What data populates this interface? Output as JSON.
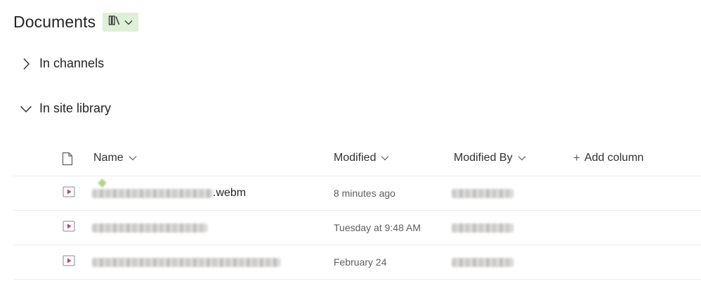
{
  "header": {
    "title": "Documents"
  },
  "sections": {
    "channels": {
      "label": "In channels",
      "expanded": false
    },
    "library": {
      "label": "In site library",
      "expanded": true
    }
  },
  "table": {
    "columns": {
      "name": "Name",
      "modified": "Modified",
      "modified_by": "Modified By",
      "add_column": "Add column"
    },
    "rows": [
      {
        "name_suffix": ".webm",
        "modified": "8 minutes ago",
        "icon": "video-file-icon"
      },
      {
        "name_suffix": "",
        "modified": "Tuesday at 9:48 AM",
        "icon": "video-file-icon"
      },
      {
        "name_suffix": "",
        "modified": "February 24",
        "icon": "video-file-icon"
      }
    ]
  },
  "colors": {
    "view_switcher_bg": "#dff0d8",
    "video_icon_accent": "#c43e64",
    "divider": "#edebe9"
  }
}
